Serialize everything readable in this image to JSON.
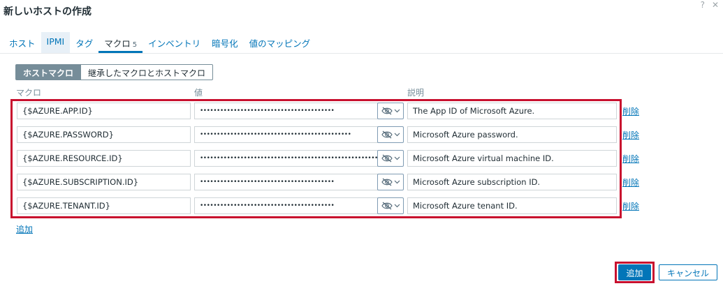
{
  "dialog": {
    "title": "新しいホストの作成",
    "help": "?",
    "close": "✕"
  },
  "tabs": [
    {
      "label": "ホスト"
    },
    {
      "label": "IPMI"
    },
    {
      "label": "タグ"
    },
    {
      "label": "マクロ",
      "count": "5"
    },
    {
      "label": "インベントリ"
    },
    {
      "label": "暗号化"
    },
    {
      "label": "値のマッピング"
    }
  ],
  "segment": {
    "host_macros": "ホストマクロ",
    "inherited_macros": "継承したマクロとホストマクロ"
  },
  "columns": {
    "macro": "マクロ",
    "value": "値",
    "description": "説明"
  },
  "macros": [
    {
      "macro": "{$AZURE.APP.ID}",
      "value": "••••••••••••••••••••••••••••••••••••••••",
      "description": "The App ID of Microsoft Azure.",
      "delete": "削除"
    },
    {
      "macro": "{$AZURE.PASSWORD}",
      "value": "•••••••••••••••••••••••••••••••••••••••••••••",
      "description": "Microsoft Azure password.",
      "delete": "削除"
    },
    {
      "macro": "{$AZURE.RESOURCE.ID}",
      "value": "••••••••••••••••••••••••••••••••••••••••••••••••••••••••••••••••",
      "description": "Microsoft Azure virtual machine ID.",
      "delete": "削除"
    },
    {
      "macro": "{$AZURE.SUBSCRIPTION.ID}",
      "value": "••••••••••••••••••••••••••••••••••••••••",
      "description": "Microsoft Azure subscription ID.",
      "delete": "削除"
    },
    {
      "macro": "{$AZURE.TENANT.ID}",
      "value": "••••••••••••••••••••••••••••••••••••••••",
      "description": "Microsoft Azure tenant ID.",
      "delete": "削除"
    }
  ],
  "add_link": "追加",
  "footer": {
    "add": "追加",
    "cancel": "キャンセル"
  },
  "colors": {
    "accent": "#0275b8",
    "highlight_border": "#c8102e",
    "segment_active": "#768d99"
  },
  "icons": {
    "value_type": "eye-slash-icon",
    "dropdown": "chevron-down-icon"
  }
}
